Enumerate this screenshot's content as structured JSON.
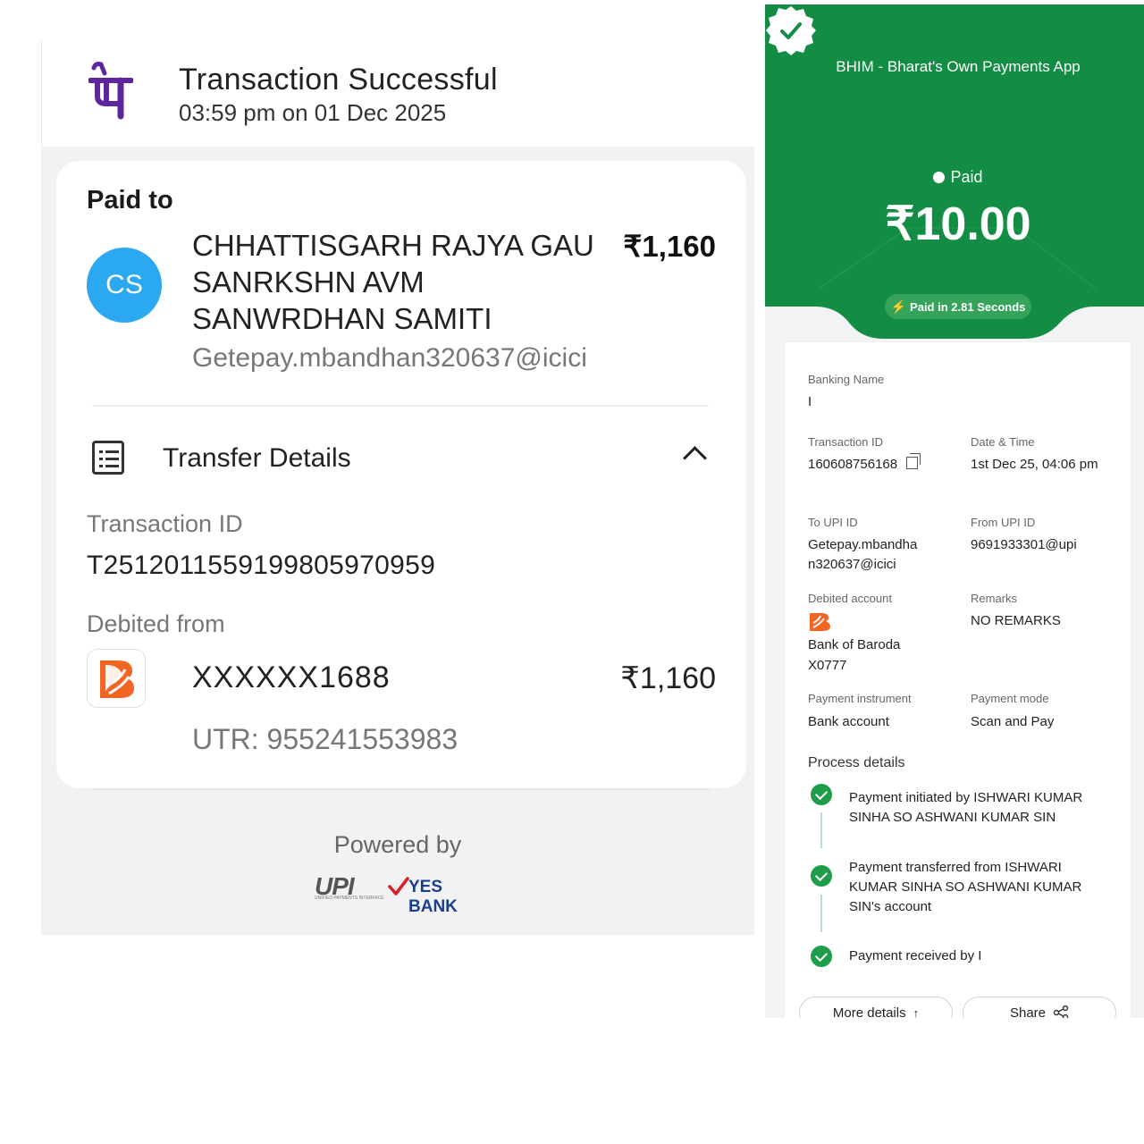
{
  "phonepe": {
    "logo_glyph": "पे",
    "title": "Transaction Successful",
    "timestamp": "03:59 pm on 01 Dec 2025",
    "paid_to_label": "Paid to",
    "avatar_initials": "CS",
    "payee_name": "CHHATTISGARH RAJYA GAU SANRKSHN AVM SANWRDHAN SAMITI",
    "amount": "₹1,160",
    "payee_upi": "Getepay.mbandhan320637@icici",
    "transfer_details_label": "Transfer Details",
    "transaction_id_label": "Transaction ID",
    "transaction_id": "T2512011559199805970959",
    "debited_from_label": "Debited from",
    "account_masked": "XXXXXX1688",
    "debited_amount": "₹1,160",
    "utr": "UTR: 955241553983",
    "powered_by": "Powered by",
    "upi_logo_text": "UPI",
    "upi_logo_subtext": "UNIFIED PAYMENTS INTERFACE",
    "bank_logo_text": "YES BANK",
    "colors": {
      "brand_purple": "#5f259f",
      "avatar_blue": "#2aa8f0",
      "bank_orange": "#f26522"
    },
    "icons": [
      "phonepe-logo",
      "transfer-details-icon",
      "chevron-up-icon",
      "bank-of-baroda-logo",
      "upi-logo",
      "yes-bank-logo"
    ]
  },
  "bhim": {
    "app_name": "BHIM - Bharat's Own Payments App",
    "status": "Paid",
    "amount": "₹10.00",
    "speed_badge": "Paid in 2.81 Seconds",
    "banking_name_label": "Banking Name",
    "banking_name": "I",
    "transaction_id_label": "Transaction ID",
    "transaction_id": "160608756168",
    "datetime_label": "Date & Time",
    "datetime": "1st Dec 25, 04:06 pm",
    "to_upi_label": "To UPI ID",
    "to_upi": "Getepay.mbandhan320637@icici",
    "from_upi_label": "From UPI ID",
    "from_upi": "9691933301@upi",
    "debited_account_label": "Debited account",
    "bank_name": "Bank of Baroda",
    "bank_account": "X0777",
    "remarks_label": "Remarks",
    "remarks": "NO REMARKS",
    "instrument_label": "Payment instrument",
    "instrument": "Bank account",
    "mode_label": "Payment mode",
    "mode": "Scan and Pay",
    "process_label": "Process details",
    "steps": [
      "Payment initiated by ISHWARI KUMAR SINHA SO ASHWANI KUMAR SIN",
      "Payment transferred from ISHWARI KUMAR SINHA SO ASHWANI KUMAR SIN's account",
      "Payment received by I"
    ],
    "more_details_label": "More details",
    "share_label": "Share",
    "colors": {
      "header_green": "#138d44",
      "check_green": "#1e9e4a",
      "bolt_amber": "#ffb300"
    },
    "icons": [
      "verified-badge-icon",
      "info-circle-icon",
      "bolt-icon",
      "copy-icon",
      "bank-of-baroda-logo",
      "check-circle-icon",
      "arrow-up-icon",
      "share-icon"
    ]
  }
}
